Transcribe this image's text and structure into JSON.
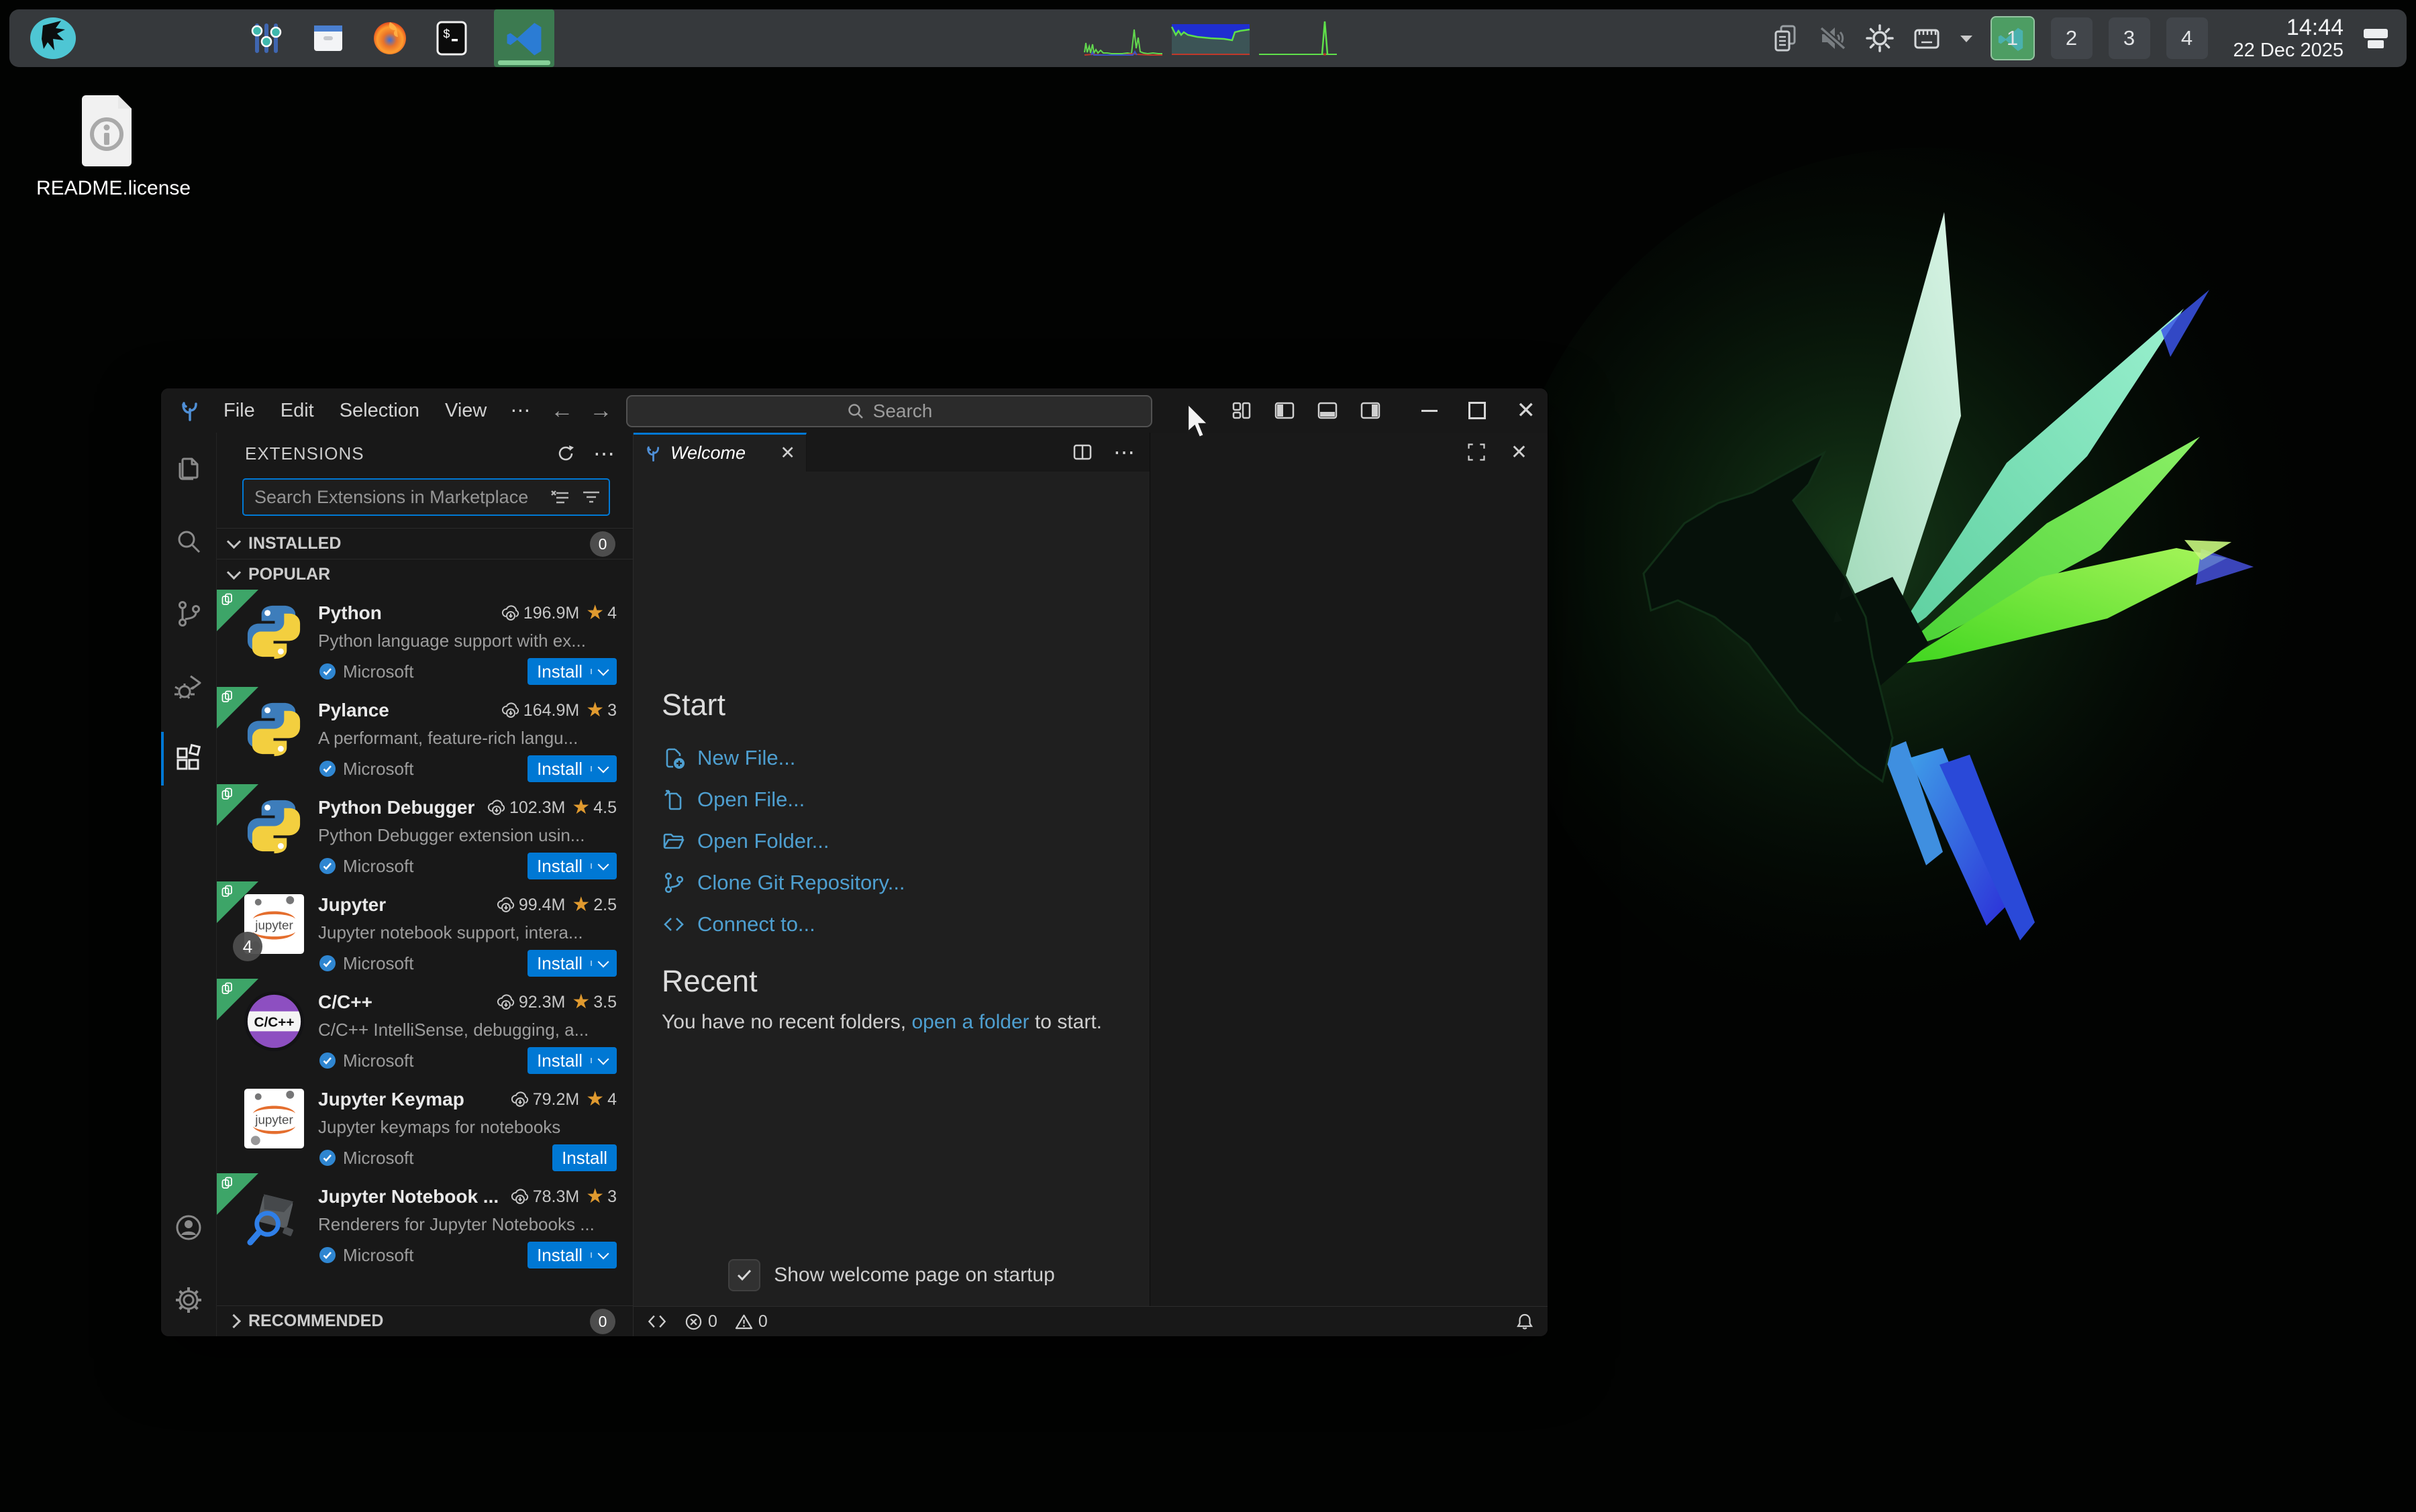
{
  "colors": {
    "accent_blue": "#0078d4",
    "link_blue": "#4e9fd0",
    "star_orange": "#e09a2f",
    "verified_blue": "#2f86d1",
    "ribbon_green": "#3da568",
    "workspace_active_green": "#4d9d63",
    "topbar_bg": "#36393c",
    "panel_bg": "#181818",
    "editor_bg": "#1f1f1f",
    "wallpaper_feather_green": "#57e83b",
    "wallpaper_feather_cyan": "#8fe3c4",
    "wallpaper_tail_blue": "#2f6fe0"
  },
  "desktop": {
    "icon_label": "README.license"
  },
  "topbar": {
    "launcher_icons": [
      "os-logo-icon",
      "mixer-icon",
      "file-manager-icon",
      "firefox-icon",
      "terminal-icon",
      "vscode-icon"
    ],
    "tray_icons": [
      "clipboard-icon",
      "volume-muted-icon",
      "brightness-icon",
      "keyboard-icon",
      "caret-down-icon",
      "tray-panel-icon"
    ],
    "workspaces": [
      {
        "label": "1",
        "active": true
      },
      {
        "label": "2",
        "active": false
      },
      {
        "label": "3",
        "active": false
      },
      {
        "label": "4",
        "active": false
      }
    ],
    "time": "14:44",
    "date": "22 Dec 2025"
  },
  "window": {
    "menu": [
      {
        "label": "File"
      },
      {
        "label": "Edit"
      },
      {
        "label": "Selection"
      },
      {
        "label": "View"
      }
    ],
    "search_placeholder": "Search"
  },
  "activity_bar": {
    "items": [
      "explorer",
      "search",
      "source-control",
      "run-debug",
      "extensions",
      "account",
      "settings"
    ]
  },
  "extensions_panel": {
    "title": "EXTENSIONS",
    "search_placeholder": "Search Extensions in Marketplace",
    "install_label": "Install",
    "sections": {
      "installed": {
        "label": "INSTALLED",
        "count": "0"
      },
      "popular": {
        "label": "POPULAR"
      },
      "recommended": {
        "label": "RECOMMENDED",
        "count": "0"
      }
    },
    "items": [
      {
        "name": "Python",
        "downloads": "196.9M",
        "rating": "4",
        "description": "Python language support with ex...",
        "publisher": "Microsoft"
      },
      {
        "name": "Pylance",
        "downloads": "164.9M",
        "rating": "3",
        "description": "A performant, feature-rich langu...",
        "publisher": "Microsoft"
      },
      {
        "name": "Python Debugger",
        "downloads": "102.3M",
        "rating": "4.5",
        "description": "Python Debugger extension usin...",
        "publisher": "Microsoft"
      },
      {
        "name": "Jupyter",
        "downloads": "99.4M",
        "rating": "2.5",
        "description": "Jupyter notebook support, intera...",
        "publisher": "Microsoft",
        "badge": "4"
      },
      {
        "name": "C/C++",
        "downloads": "92.3M",
        "rating": "3.5",
        "description": "C/C++ IntelliSense, debugging, a...",
        "publisher": "Microsoft"
      },
      {
        "name": "Jupyter Keymap",
        "downloads": "79.2M",
        "rating": "4",
        "description": "Jupyter keymaps for notebooks",
        "publisher": "Microsoft"
      },
      {
        "name": "Jupyter Notebook ...",
        "downloads": "78.3M",
        "rating": "3",
        "description": "Renderers for Jupyter Notebooks ...",
        "publisher": "Microsoft"
      }
    ]
  },
  "editor": {
    "tab_label": "Welcome",
    "start": {
      "heading": "Start",
      "links": [
        {
          "label": "New File..."
        },
        {
          "label": "Open File..."
        },
        {
          "label": "Open Folder..."
        },
        {
          "label": "Clone Git Repository..."
        },
        {
          "label": "Connect to..."
        }
      ]
    },
    "recent": {
      "heading": "Recent",
      "text_before": "You have no recent folders, ",
      "link_label": "open a folder",
      "text_after": " to start."
    },
    "checkbox_label": "Show welcome page on startup"
  },
  "status_bar": {
    "errors": "0",
    "warnings": "0"
  }
}
